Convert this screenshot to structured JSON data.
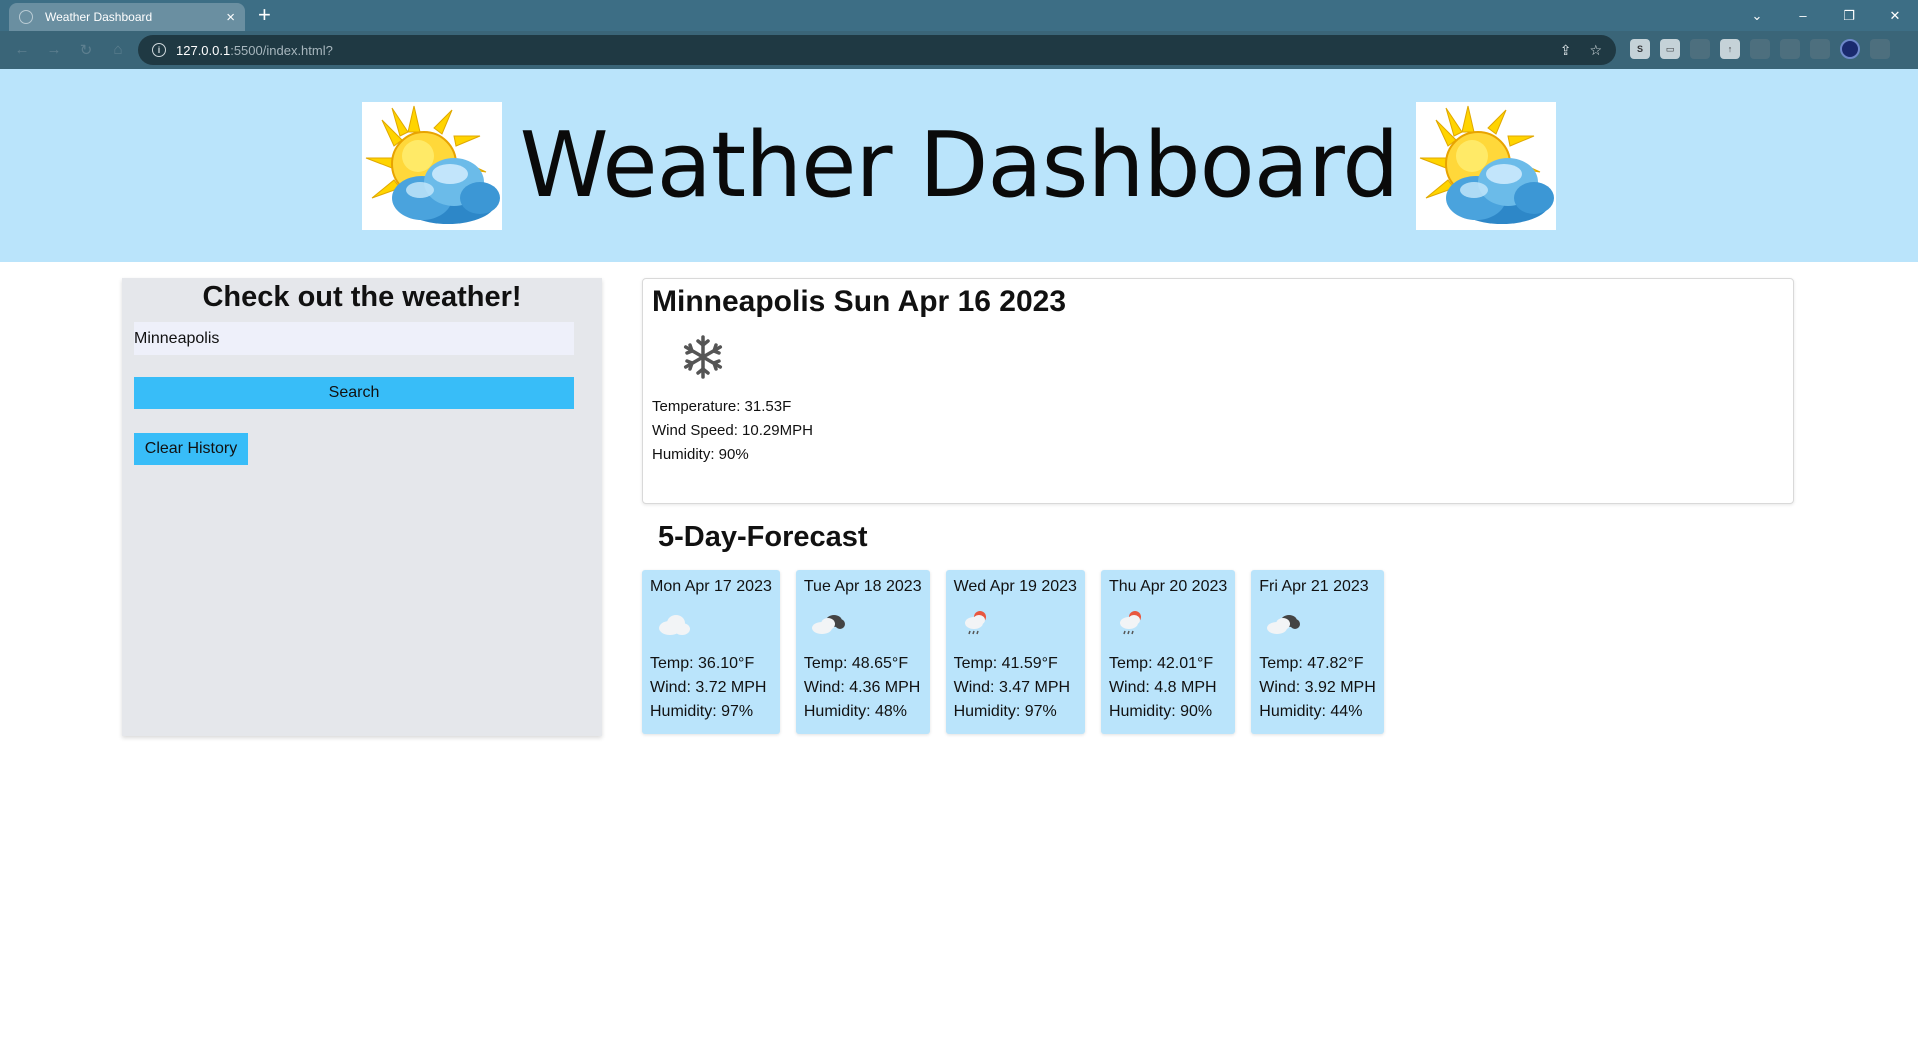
{
  "browser": {
    "tab_title": "Weather Dashboard",
    "tab_close": "×",
    "new_tab": "+",
    "url_host": "127.0.0.1",
    "url_path": ":5500/index.html?",
    "window_controls": [
      "⌄",
      "–",
      "❐",
      "✕"
    ]
  },
  "header": {
    "title": "Weather Dashboard"
  },
  "sidebar": {
    "heading": "Check out the weather!",
    "search_value": "Minneapolis",
    "search_button": "Search",
    "clear_button": "Clear History"
  },
  "current": {
    "title": "Minneapolis Sun Apr 16 2023",
    "icon": "snowflake-icon",
    "temperature": "Temperature: 31.53F",
    "wind": "Wind Speed: 10.29MPH",
    "humidity": "Humidity: 90%"
  },
  "forecast": {
    "title": "5-Day-Forecast",
    "days": [
      {
        "date": "Mon Apr 17 2023",
        "icon": "cloud-icon",
        "temp": "Temp: 36.10°F",
        "wind": "Wind: 3.72 MPH",
        "humidity": "Humidity: 97%"
      },
      {
        "date": "Tue Apr 18 2023",
        "icon": "broken-clouds-icon",
        "temp": "Temp: 48.65°F",
        "wind": "Wind: 4.36 MPH",
        "humidity": "Humidity: 48%"
      },
      {
        "date": "Wed Apr 19 2023",
        "icon": "rain-icon",
        "temp": "Temp: 41.59°F",
        "wind": "Wind: 3.47 MPH",
        "humidity": "Humidity: 97%"
      },
      {
        "date": "Thu Apr 20 2023",
        "icon": "rain-icon",
        "temp": "Temp: 42.01°F",
        "wind": "Wind: 4.8 MPH",
        "humidity": "Humidity: 90%"
      },
      {
        "date": "Fri Apr 21 2023",
        "icon": "broken-clouds-icon",
        "temp": "Temp: 47.82°F",
        "wind": "Wind: 3.92 MPH",
        "humidity": "Humidity: 44%"
      }
    ]
  },
  "colors": {
    "banner_bg": "#bae4fb",
    "button": "#38bdf8",
    "sidebar_bg": "#e5e7eb",
    "card_bg": "#bae4fb"
  }
}
